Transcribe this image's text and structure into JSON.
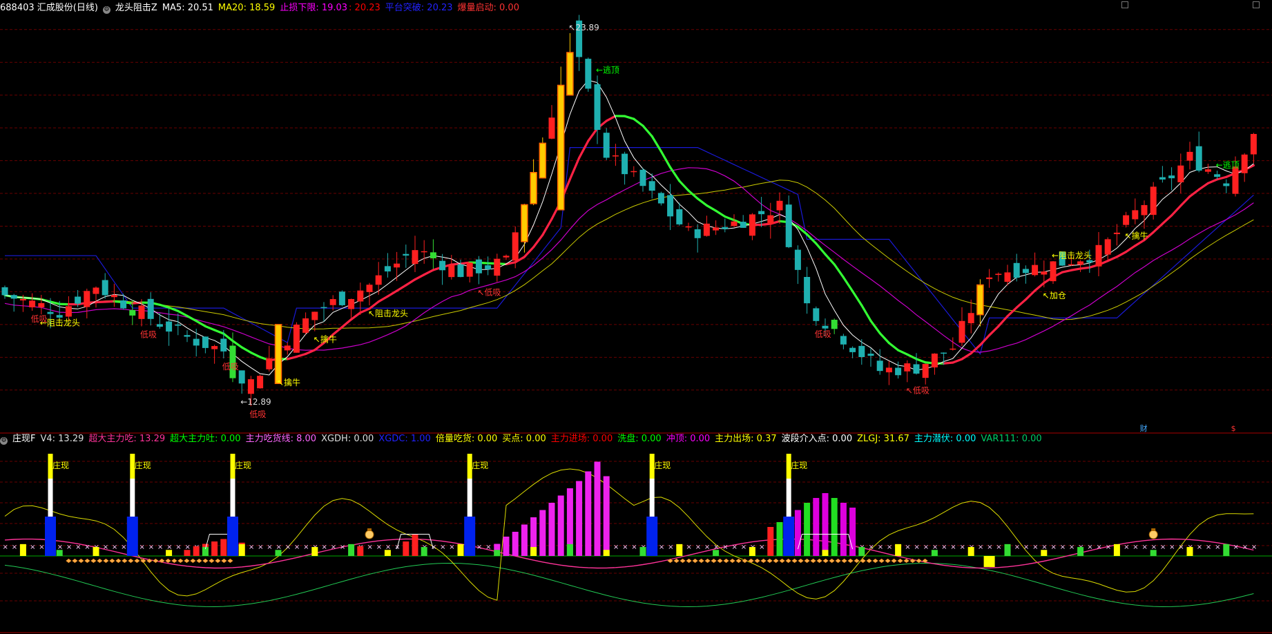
{
  "top_header": {
    "stock": "688403 汇成股份(日线)",
    "indicator": "龙头阻击Z",
    "items": [
      {
        "label": "MA5: 20.51",
        "color": "#ffffff"
      },
      {
        "label": "MA20: 18.59",
        "color": "#ffff00"
      },
      {
        "label": "止损下限: 19.03",
        "color": "#ff00ff"
      },
      {
        "label": ": 20.23",
        "color": "#ff0000"
      },
      {
        "label": "平台突破: 20.23",
        "color": "#2222ff"
      },
      {
        "label": "爆量启动: 0.00",
        "color": "#ff3333"
      }
    ]
  },
  "bottom_header": {
    "indicator": "庄现F",
    "items": [
      {
        "label": "V4: 13.29",
        "color": "#dddddd"
      },
      {
        "label": "超大主力吃: 13.29",
        "color": "#ff3399"
      },
      {
        "label": "超大主力吐: 0.00",
        "color": "#00ff00"
      },
      {
        "label": "主力吃货线: 8.00",
        "color": "#ff66ff"
      },
      {
        "label": "XGDH: 0.00",
        "color": "#dddddd"
      },
      {
        "label": "XGDC: 1.00",
        "color": "#2222ff"
      },
      {
        "label": "倍量吃货: 0.00",
        "color": "#ffff00"
      },
      {
        "label": "买点: 0.00",
        "color": "#ffff00"
      },
      {
        "label": "主力进场: 0.00",
        "color": "#ff0000"
      },
      {
        "label": "洗盘: 0.00",
        "color": "#00ff00"
      },
      {
        "label": "冲顶: 0.00",
        "color": "#ff00ff"
      },
      {
        "label": "主力出场: 0.37",
        "color": "#ffff00"
      },
      {
        "label": "波段介入点: 0.00",
        "color": "#ffffff"
      },
      {
        "label": "ZLGJ: 31.67",
        "color": "#ffff00"
      },
      {
        "label": "主力潜伏: 0.00",
        "color": "#00ffff"
      },
      {
        "label": "VAR111: 0.00",
        "color": "#00cc66"
      }
    ]
  },
  "chart_data": [
    {
      "type": "candlestick",
      "panel": "price",
      "n_bars": 138,
      "anchor_bars": [
        0,
        6,
        10,
        14,
        20,
        24,
        26,
        30,
        34,
        40,
        45,
        50,
        55,
        60,
        62,
        66,
        70,
        75,
        80,
        85,
        88,
        92,
        96,
        100,
        104,
        108,
        112,
        116,
        120,
        125,
        130,
        134,
        137
      ],
      "anchor_close": [
        15.9,
        15.4,
        16.2,
        15.5,
        14.6,
        14.2,
        12.9,
        14.3,
        15.4,
        16.2,
        17.3,
        16.6,
        16.9,
        21.5,
        23.89,
        20.2,
        19.2,
        17.8,
        18.1,
        18.6,
        15.6,
        14.6,
        13.6,
        13.7,
        14.3,
        16.6,
        16.7,
        16.9,
        17.2,
        18.7,
        20.1,
        19.4,
        20.9
      ],
      "price_ticks": [
        24,
        23,
        22,
        21,
        20,
        19,
        18,
        17,
        16,
        15,
        14,
        13
      ],
      "annotations": [
        {
          "bar": 4,
          "text": "←阻击龙头",
          "color": "#ffff00",
          "at": "low"
        },
        {
          "bar": 3,
          "text": "低吸",
          "color": "#ff3333",
          "at": "low"
        },
        {
          "bar": 15,
          "text": "低吸",
          "color": "#ff3333",
          "at": "low"
        },
        {
          "bar": 24,
          "text": "低吸",
          "color": "#ff3333",
          "at": "low"
        },
        {
          "bar": 26,
          "text": "←12.89",
          "color": "#dddddd",
          "at": "low"
        },
        {
          "bar": 27,
          "text": "低吸",
          "color": "#ff3333",
          "at": "low"
        },
        {
          "bar": 30,
          "text": "↖擒牛",
          "color": "#ffff00",
          "at": "low"
        },
        {
          "bar": 34,
          "text": "↖擒牛",
          "color": "#ffff00",
          "at": "low"
        },
        {
          "bar": 40,
          "text": "↖阻击龙头",
          "color": "#ffff00",
          "at": "low"
        },
        {
          "bar": 52,
          "text": "↖低吸",
          "color": "#ff3333",
          "at": "low"
        },
        {
          "bar": 62,
          "text": "↖23.89",
          "color": "#dddddd",
          "at": "high"
        },
        {
          "bar": 65,
          "text": "←逃顶",
          "color": "#00ff00",
          "at": "high"
        },
        {
          "bar": 89,
          "text": "低吸",
          "color": "#ff3333",
          "at": "low"
        },
        {
          "bar": 99,
          "text": "↖低吸",
          "color": "#ff3333",
          "at": "low"
        },
        {
          "bar": 114,
          "text": "↖加仓",
          "color": "#ffff00",
          "at": "low"
        },
        {
          "bar": 115,
          "text": "←阻击龙头",
          "color": "#ffff00",
          "at": "high"
        },
        {
          "bar": 123,
          "text": "↖擒牛",
          "color": "#ffff00",
          "at": "low"
        },
        {
          "bar": 133,
          "text": "←逃顶",
          "color": "#00ff00",
          "at": "high"
        }
      ],
      "bottom_marks": [
        {
          "bar": 123,
          "text": "财",
          "color": "#44aaff"
        },
        {
          "bar": 133,
          "text": "$",
          "color": "#ff3333"
        }
      ]
    },
    {
      "type": "bar",
      "panel": "indicator",
      "zhuangxian_bars": [
        5,
        14,
        25,
        51,
        71,
        86
      ],
      "zhuangxian_label": "庄现",
      "columns": [
        {
          "start": 20,
          "values": [
            0.25,
            0.4,
            0.5,
            0.6,
            0.7,
            0.8,
            0.55
          ]
        },
        {
          "start": 39,
          "values": [
            0.4
          ]
        },
        {
          "start": 44,
          "values": [
            0.6,
            0.9
          ]
        },
        {
          "start": 54,
          "values": [
            0.5,
            0.8,
            1.0,
            1.3,
            1.6,
            1.9,
            2.2,
            2.5,
            2.8,
            3.1,
            3.5,
            3.9,
            3.3
          ]
        },
        {
          "start": 84,
          "values": [
            1.2,
            1.4,
            1.6,
            1.9,
            2.2,
            2.4,
            2.6,
            2.4,
            2.2,
            2.0
          ]
        }
      ]
    }
  ]
}
